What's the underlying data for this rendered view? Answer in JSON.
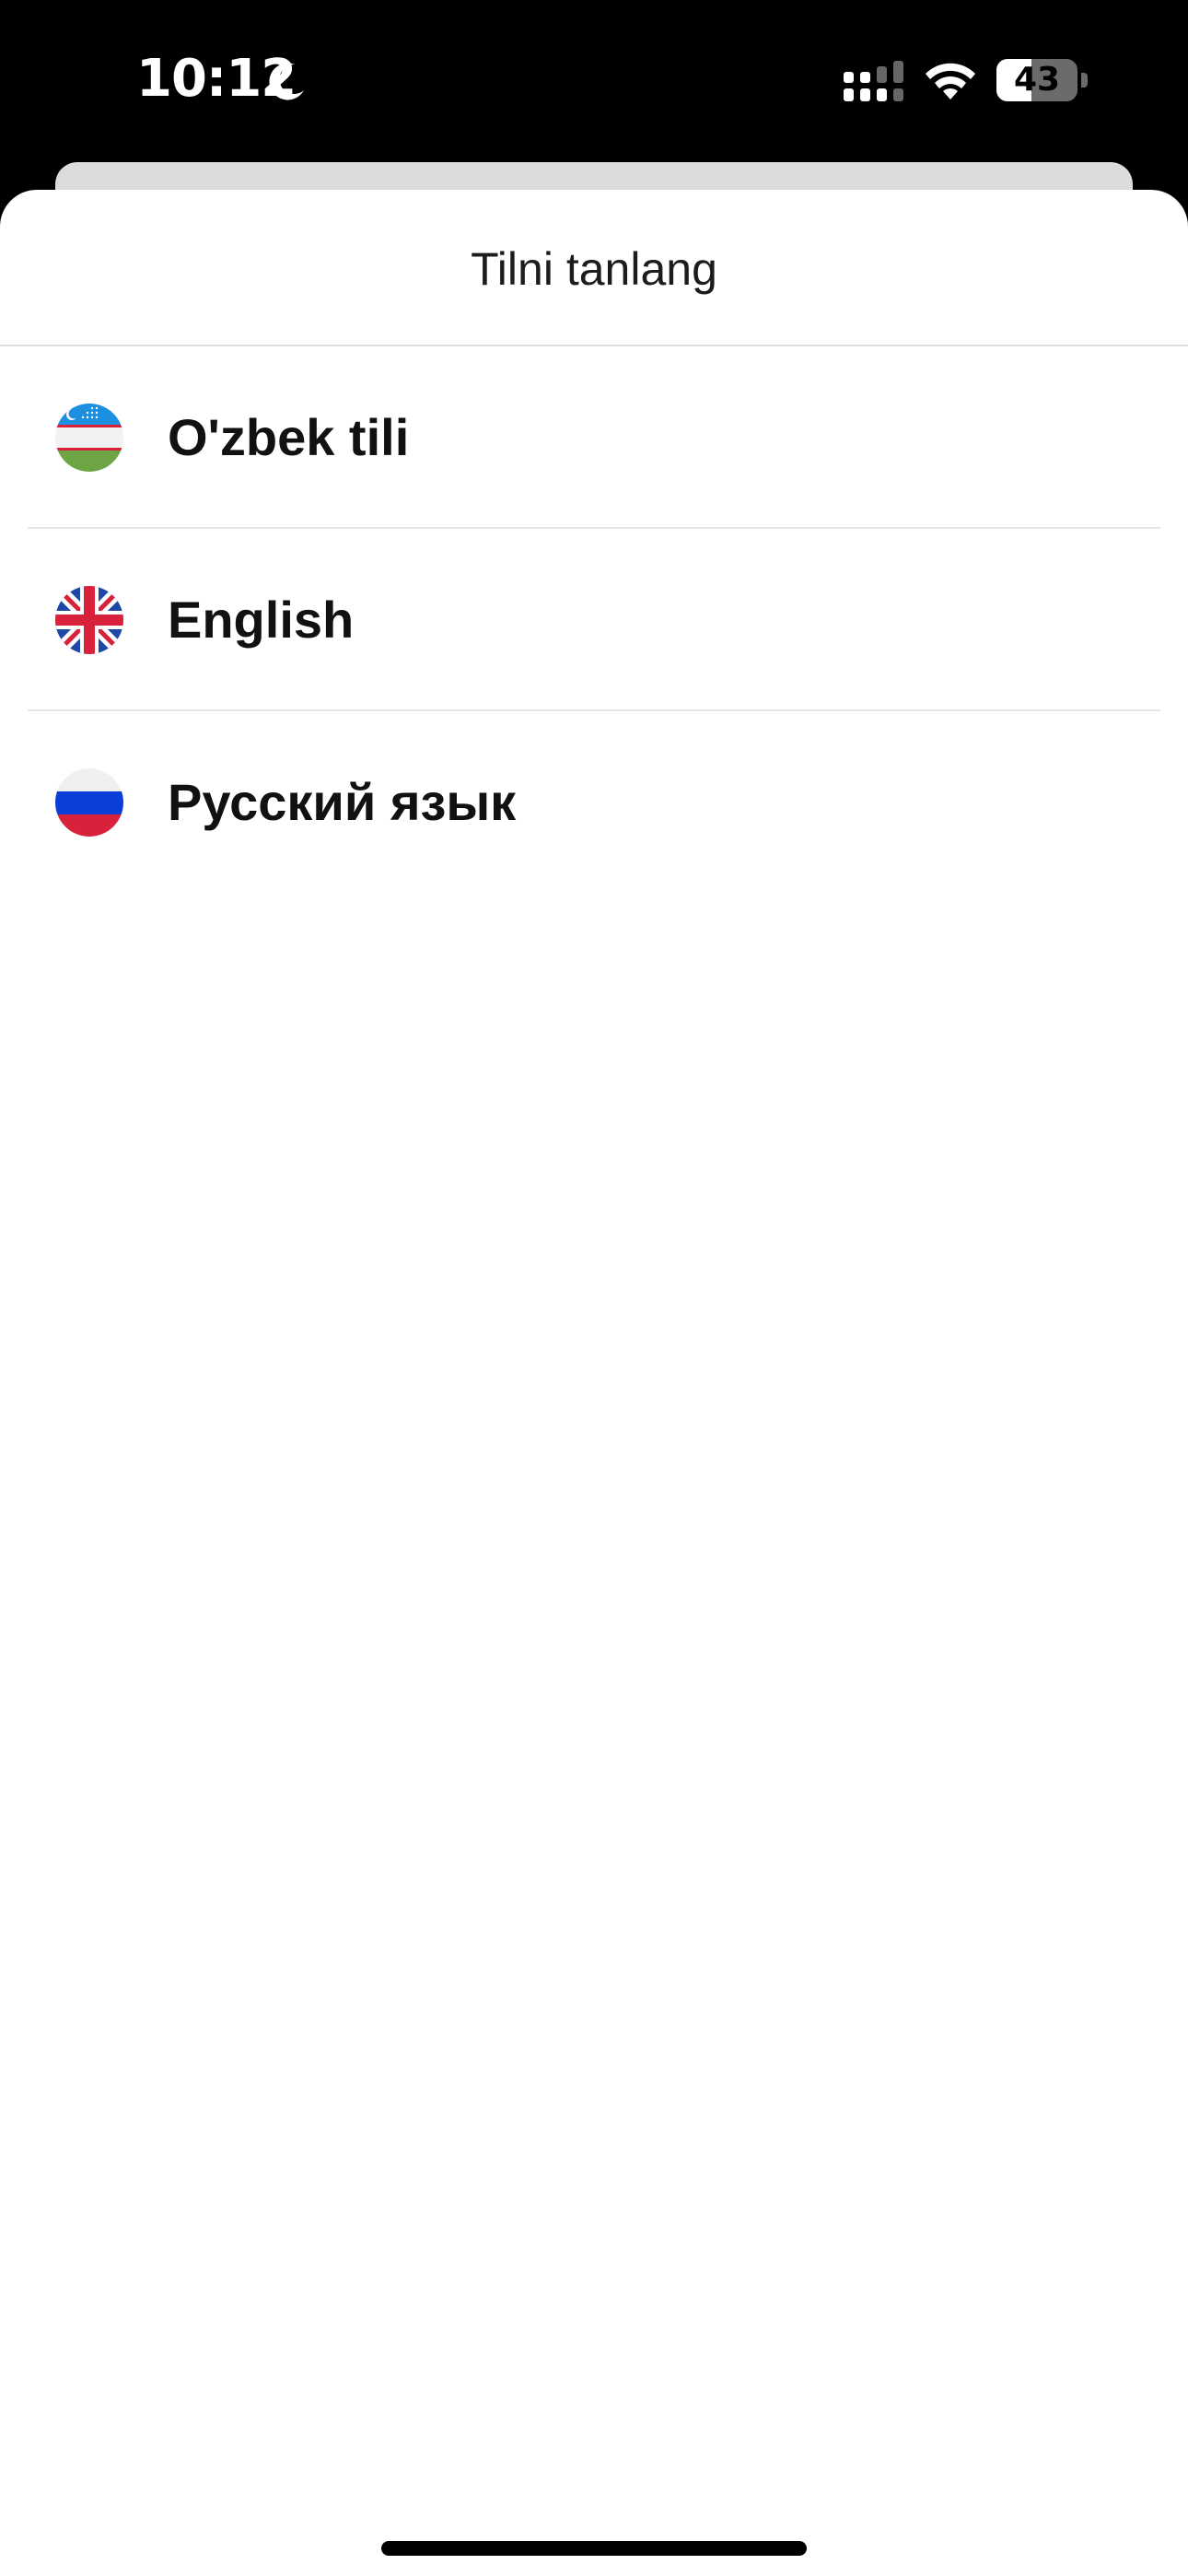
{
  "status_bar": {
    "time": "10:12",
    "battery_level": "43",
    "battery_fraction": 0.43,
    "icons": [
      "moon-icon",
      "signal-icon",
      "wifi-icon",
      "battery-icon"
    ]
  },
  "sheet": {
    "title": "Tilni tanlang"
  },
  "languages": [
    {
      "label": "O'zbek tili",
      "flag": "uzbekistan-flag-icon"
    },
    {
      "label": "English",
      "flag": "uk-flag-icon"
    },
    {
      "label": "Русский язык",
      "flag": "russia-flag-icon"
    }
  ],
  "colors": {
    "sheet_background": "#ffffff",
    "status_bar_background": "#000000",
    "text": "#111111",
    "divider": "#e6e6e6"
  }
}
